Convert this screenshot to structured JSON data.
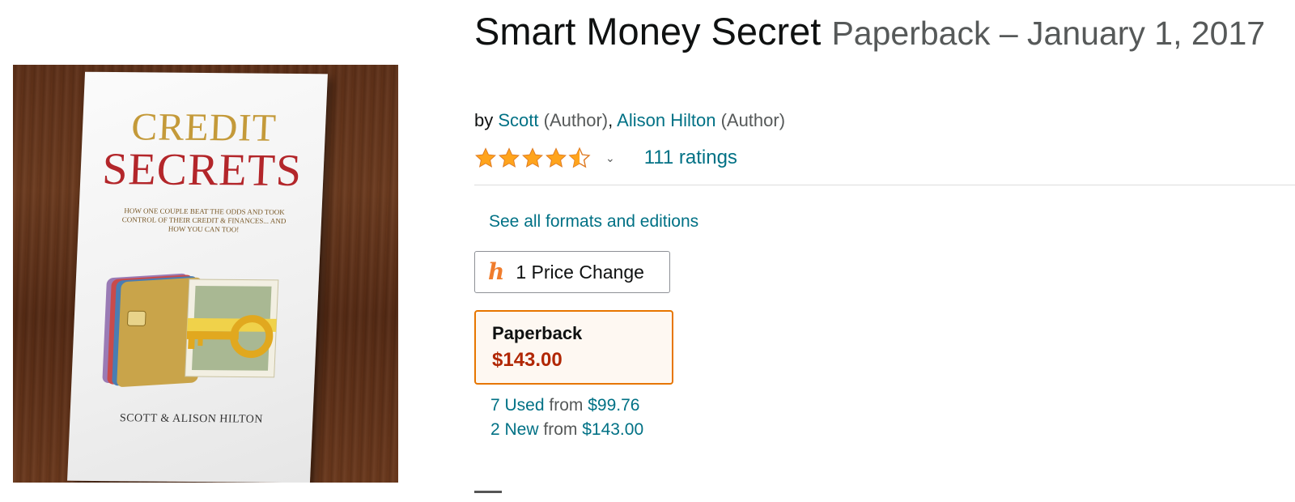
{
  "product": {
    "title": "Smart Money Secret",
    "format_date": "Paperback – January 1, 2017",
    "byline": {
      "prefix": "by",
      "authors": [
        {
          "name": "Scott",
          "role": "(Author)"
        },
        {
          "name": "Alison Hilton",
          "role": "(Author)"
        }
      ]
    },
    "rating": {
      "stars": 4.5,
      "count_label": "111 ratings"
    },
    "see_formats_label": "See all formats and editions",
    "price_change_label": "1 Price Change",
    "format_card": {
      "name": "Paperback",
      "price": "$143.00"
    },
    "offers": [
      {
        "link": "7 Used",
        "from": "from",
        "price": "$99.76"
      },
      {
        "link": "2 New",
        "from": "from",
        "price": "$143.00"
      }
    ]
  },
  "cover": {
    "title_line_1": "CREDIT",
    "title_line_2": "SECRETS",
    "subtitle": "How One Couple Beat the Odds and Took Control of Their Credit & Finances... And How You Can Too!",
    "authors": "Scott & Alison Hilton"
  },
  "icons": {
    "honey": "honey-icon",
    "star": "star-icon",
    "chevron": "chevron-down-icon"
  },
  "colors": {
    "link": "#007185",
    "star": "#ffa41c",
    "price": "#b12704",
    "selected_border": "#e77600"
  }
}
